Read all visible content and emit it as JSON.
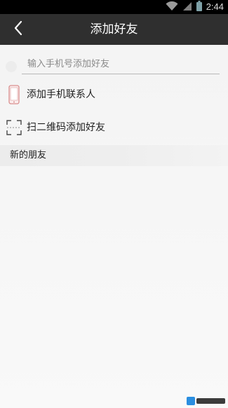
{
  "status_bar": {
    "time": "2:44",
    "icons": [
      "wifi-icon",
      "signal-icon",
      "battery-icon"
    ]
  },
  "title_bar": {
    "title": "添加好友",
    "back_icon": "chevron-left-icon"
  },
  "search": {
    "placeholder": "输入手机号添加好友",
    "value": ""
  },
  "menu": {
    "items": [
      {
        "label": "添加手机联系人",
        "icon": "phone-icon"
      },
      {
        "label": "扫二维码添加好友",
        "icon": "scan-icon"
      }
    ]
  },
  "new_friends": {
    "label": "新的朋友"
  },
  "colors": {
    "title_bar_bg": "#2f2f2f",
    "status_bar_bg": "#000000",
    "page_bg": "#f6f6f6",
    "phone_icon_accent": "#e8a4a4"
  }
}
